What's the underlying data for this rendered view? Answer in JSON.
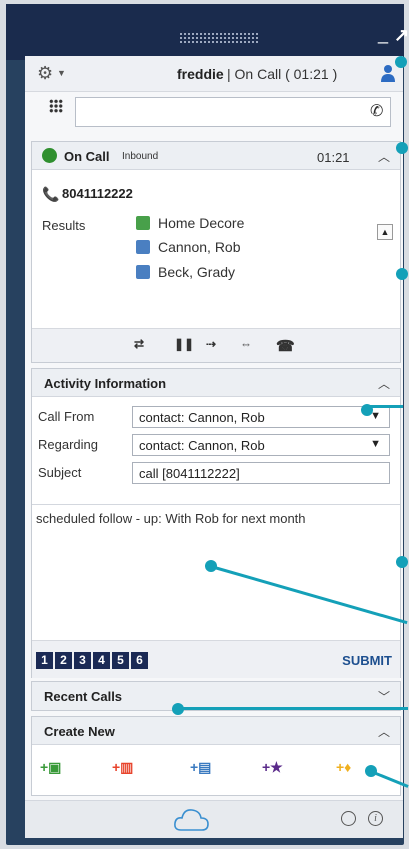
{
  "header": {
    "username": "freddie",
    "status": "| On Call ( 01:21 )"
  },
  "call": {
    "title": "On Call",
    "direction": "Inbound",
    "timer": "01:21",
    "number": "8041112222",
    "results_label": "Results",
    "results": [
      {
        "icon": "house-icon",
        "name": "Home Decore"
      },
      {
        "icon": "contact-card-icon",
        "name": "Cannon, Rob"
      },
      {
        "icon": "contact-card-icon",
        "name": "Beck, Grady"
      }
    ],
    "controls": [
      "mute",
      "hold",
      "transfer",
      "conference",
      "end-call"
    ]
  },
  "activity": {
    "title": "Activity Information",
    "call_from_label": "Call From",
    "call_from_value": "contact: Cannon, Rob",
    "regarding_label": "Regarding",
    "regarding_value": "contact: Cannon, Rob",
    "subject_label": "Subject",
    "subject_value": "call [8041112222]",
    "notes": "scheduled follow - up: With Rob for next month",
    "pages": [
      "1",
      "2",
      "3",
      "4",
      "5",
      "6"
    ],
    "submit_label": "SUBMIT"
  },
  "recent_calls": {
    "title": "Recent Calls"
  },
  "create_new": {
    "title": "Create New",
    "items": [
      {
        "icon": "new-contact-icon",
        "color": "#3a9a3a"
      },
      {
        "icon": "new-company-icon",
        "color": "#e8442c"
      },
      {
        "icon": "new-card-icon",
        "color": "#3a7ac0"
      },
      {
        "icon": "new-star-icon",
        "color": "#5a2a8a"
      },
      {
        "icon": "new-idea-icon",
        "color": "#f0b020"
      }
    ]
  },
  "colors": {
    "titlebar": "#1a2b4d",
    "frame": "#27415f",
    "accent_callout": "#14a0b8",
    "page_button": "#1b2a55"
  }
}
